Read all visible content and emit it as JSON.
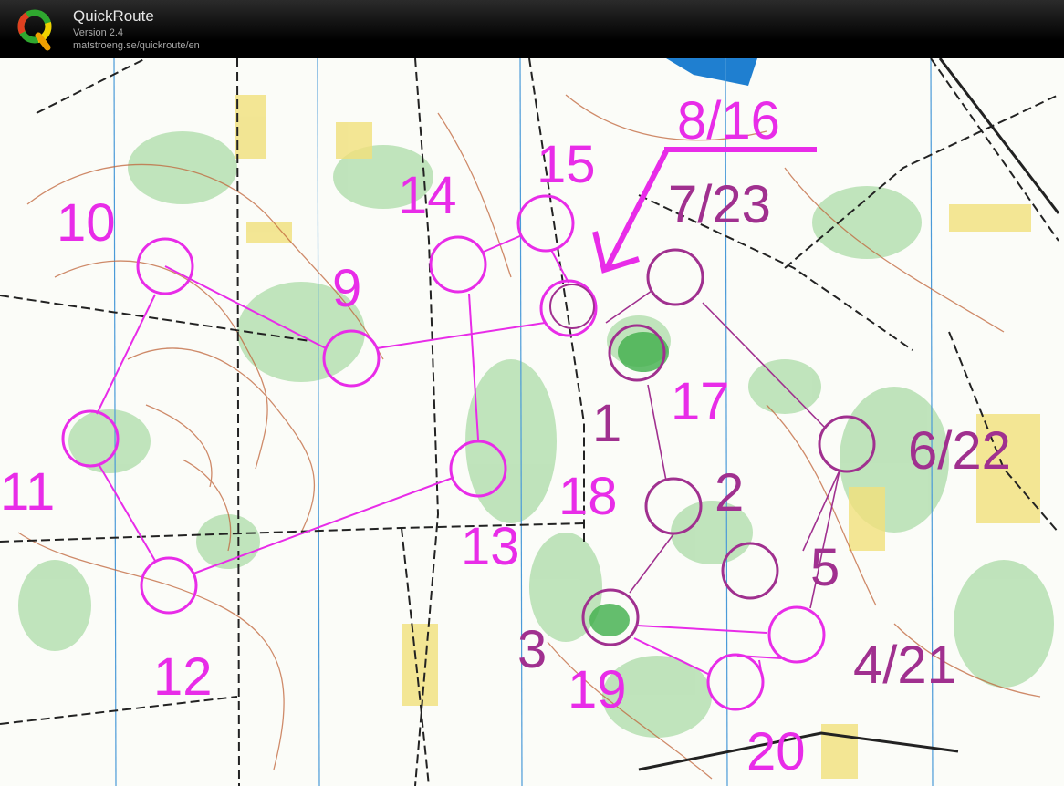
{
  "app": {
    "title": "QuickRoute",
    "version": "Version 2.4",
    "url": "matstroeng.se/quickroute/en"
  },
  "colors": {
    "course": "#e82ce8",
    "course_dark": "#a0308f",
    "map_green": "#7fc97f",
    "contour": "#c0643a",
    "water": "#1f7fd0"
  },
  "controls": [
    {
      "label": "1"
    },
    {
      "label": "2"
    },
    {
      "label": "3"
    },
    {
      "label": "4/21"
    },
    {
      "label": "5"
    },
    {
      "label": "6/22"
    },
    {
      "label": "7/23"
    },
    {
      "label": "8/16"
    },
    {
      "label": "9"
    },
    {
      "label": "10"
    },
    {
      "label": "11"
    },
    {
      "label": "12"
    },
    {
      "label": "13"
    },
    {
      "label": "14"
    },
    {
      "label": "15"
    },
    {
      "label": "17"
    },
    {
      "label": "18"
    },
    {
      "label": "19"
    },
    {
      "label": "20"
    }
  ]
}
